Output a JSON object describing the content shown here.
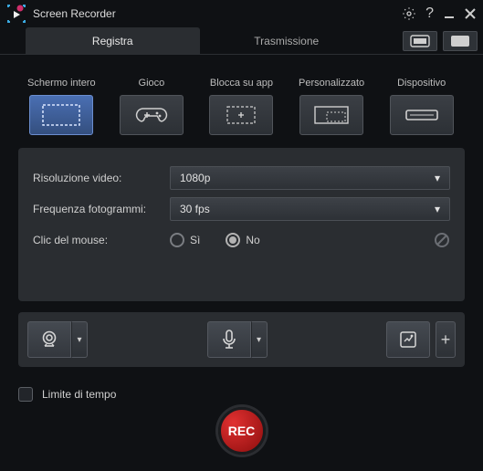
{
  "app": {
    "title": "Screen Recorder"
  },
  "tabs": {
    "record": "Registra",
    "stream": "Trasmissione"
  },
  "modes": {
    "fullscreen": "Schermo intero",
    "game": "Gioco",
    "lockapp": "Blocca su app",
    "custom": "Personalizzato",
    "device": "Dispositivo"
  },
  "settings": {
    "resolution_label": "Risoluzione video:",
    "resolution_value": "1080p",
    "framerate_label": "Frequenza fotogrammi:",
    "framerate_value": "30 fps",
    "mouseclick_label": "Clic del mouse:",
    "mouseclick_yes": "Sì",
    "mouseclick_no": "No"
  },
  "footer": {
    "timelimit": "Limite di tempo",
    "rec": "REC"
  }
}
